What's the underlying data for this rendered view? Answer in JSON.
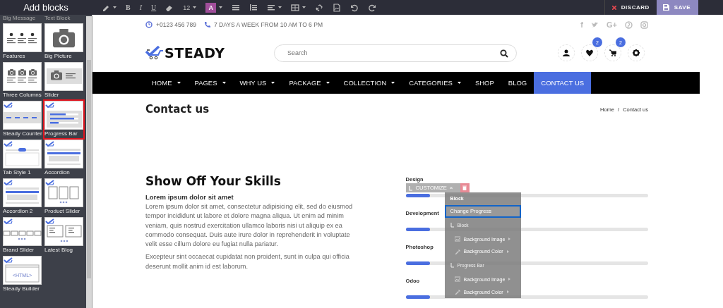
{
  "toolbar": {
    "title": "Add blocks",
    "tools": [
      {
        "kind": "pen",
        "dropdown": true
      },
      {
        "kind": "bold",
        "label": "B",
        "dropdown": false
      },
      {
        "kind": "italic",
        "label": "I",
        "dropdown": false
      },
      {
        "kind": "underline",
        "label": "U",
        "dropdown": false
      },
      {
        "kind": "eraser",
        "dropdown": false
      },
      {
        "kind": "size",
        "label": "12",
        "dropdown": true
      },
      {
        "kind": "color",
        "label": "A",
        "dropdown": true
      },
      {
        "kind": "ul",
        "dropdown": false
      },
      {
        "kind": "ol",
        "dropdown": false
      },
      {
        "kind": "align",
        "dropdown": true
      },
      {
        "kind": "table",
        "dropdown": true
      },
      {
        "kind": "link",
        "dropdown": false
      },
      {
        "kind": "file",
        "dropdown": false
      },
      {
        "kind": "undo",
        "dropdown": false
      },
      {
        "kind": "redo",
        "dropdown": false
      }
    ],
    "discard": "DISCARD",
    "save": "SAVE"
  },
  "sidebar": {
    "blocks": [
      {
        "label": "Big Message",
        "kind": "cut",
        "badge": false,
        "selected": false
      },
      {
        "label": "Text Block",
        "kind": "cut",
        "badge": false,
        "selected": false
      },
      {
        "label": "Features",
        "kind": "features",
        "badge": false,
        "selected": false
      },
      {
        "label": "Big Picture",
        "kind": "camera",
        "badge": false,
        "selected": false
      },
      {
        "label": "Three Columns",
        "kind": "columns",
        "badge": false,
        "selected": false
      },
      {
        "label": "Slider",
        "kind": "slider",
        "badge": false,
        "selected": false
      },
      {
        "label": "Steady Counter",
        "kind": "counter",
        "badge": true,
        "selected": false
      },
      {
        "label": "Progress Bar",
        "kind": "bars",
        "badge": true,
        "selected": true
      },
      {
        "label": "Tab Style 1",
        "kind": "tabs",
        "badge": true,
        "selected": false
      },
      {
        "label": "Accordion",
        "kind": "accordion",
        "badge": true,
        "selected": false
      },
      {
        "label": "Accordion 2",
        "kind": "accordion",
        "badge": true,
        "selected": false
      },
      {
        "label": "Product Slider",
        "kind": "product",
        "badge": true,
        "selected": false
      },
      {
        "label": "Brand Slider",
        "kind": "brand",
        "badge": true,
        "selected": false
      },
      {
        "label": "Latest Blog",
        "kind": "blog",
        "badge": true,
        "selected": false
      },
      {
        "label": "Steady Builder",
        "kind": "html",
        "badge": true,
        "selected": false,
        "thumb_text": "<HTML>"
      }
    ]
  },
  "topbar": {
    "contacts": [
      {
        "kind": "clock",
        "text": "+0123 456 789"
      },
      {
        "kind": "phone",
        "text": "7 DAYS A WEEK FROM 10 AM TO 6 PM"
      }
    ],
    "socials": [
      {
        "kind": "letter",
        "glyph": "f"
      },
      {
        "kind": "bird"
      },
      {
        "kind": "letter",
        "glyph": "G+"
      },
      {
        "kind": "pin"
      },
      {
        "kind": "camera"
      }
    ]
  },
  "header": {
    "logo": "STEADY",
    "search": {
      "placeholder": "Search"
    },
    "icons": [
      {
        "kind": "user"
      },
      {
        "kind": "heart",
        "badge": "2"
      },
      {
        "kind": "cart",
        "badge": "2"
      },
      {
        "kind": "gear"
      }
    ]
  },
  "nav": [
    {
      "label": "HOME",
      "dropdown": true,
      "selected": false
    },
    {
      "label": "PAGES",
      "dropdown": true,
      "selected": false
    },
    {
      "label": "WHY US",
      "dropdown": true,
      "selected": false
    },
    {
      "label": "PACKAGE",
      "dropdown": true,
      "selected": false
    },
    {
      "label": "COLLECTION",
      "dropdown": true,
      "selected": false
    },
    {
      "label": "CATEGORIES",
      "dropdown": true,
      "selected": false
    },
    {
      "label": "SHOP",
      "dropdown": false,
      "selected": false
    },
    {
      "label": "BLOG",
      "dropdown": false,
      "selected": false
    },
    {
      "label": "CONTACT US",
      "dropdown": false,
      "selected": true
    }
  ],
  "page_title": "Contact us",
  "breadcrumb": {
    "items": [
      "Home",
      "Contact us"
    ],
    "separator": "/"
  },
  "skills": {
    "heading": "Show Off Your Skills",
    "subheading": "Lorem ipsum dolor sit amet",
    "paragraphs": [
      "Lorem ipsum dolor sit amet, consectetur adipisicing elit, sed do eiusmod tempor incididunt ut labore et dolore magna aliqua. Ut enim ad minim veniam, quis nostrud exercitation ullamco laboris nisi ut aliquip ex ea commodo consequat. Duis aute irure dolor in reprehenderit in voluptate velit esse cillum dolore eu fugiat nulla pariatur.",
      "Excepteur sint occaecat cupidatat non proident, sunt in culpa qui officia deserunt mollit anim id est laborum."
    ],
    "bars": [
      {
        "name": "Design",
        "level": 0.1
      },
      {
        "name": "Development",
        "level": 0.1
      },
      {
        "name": "Photoshop",
        "level": 0.1
      },
      {
        "name": "Odoo",
        "level": 0.1
      }
    ]
  },
  "customize": {
    "title": "CUSTOMIZE",
    "close": "×",
    "items": [
      {
        "kind": "heading",
        "label": "Block",
        "selected": false
      },
      {
        "kind": "option",
        "label": "Change Progress",
        "selected": true
      },
      {
        "kind": "section",
        "label": "Block",
        "selected": false
      },
      {
        "kind": "image",
        "label": "Background Image",
        "selected": false
      },
      {
        "kind": "color",
        "label": "Background Color",
        "selected": false
      },
      {
        "kind": "section",
        "label": "Progress Bar",
        "selected": false
      },
      {
        "kind": "image",
        "label": "Background Image",
        "selected": false
      },
      {
        "kind": "color",
        "label": "Background Color",
        "selected": false
      }
    ]
  }
}
